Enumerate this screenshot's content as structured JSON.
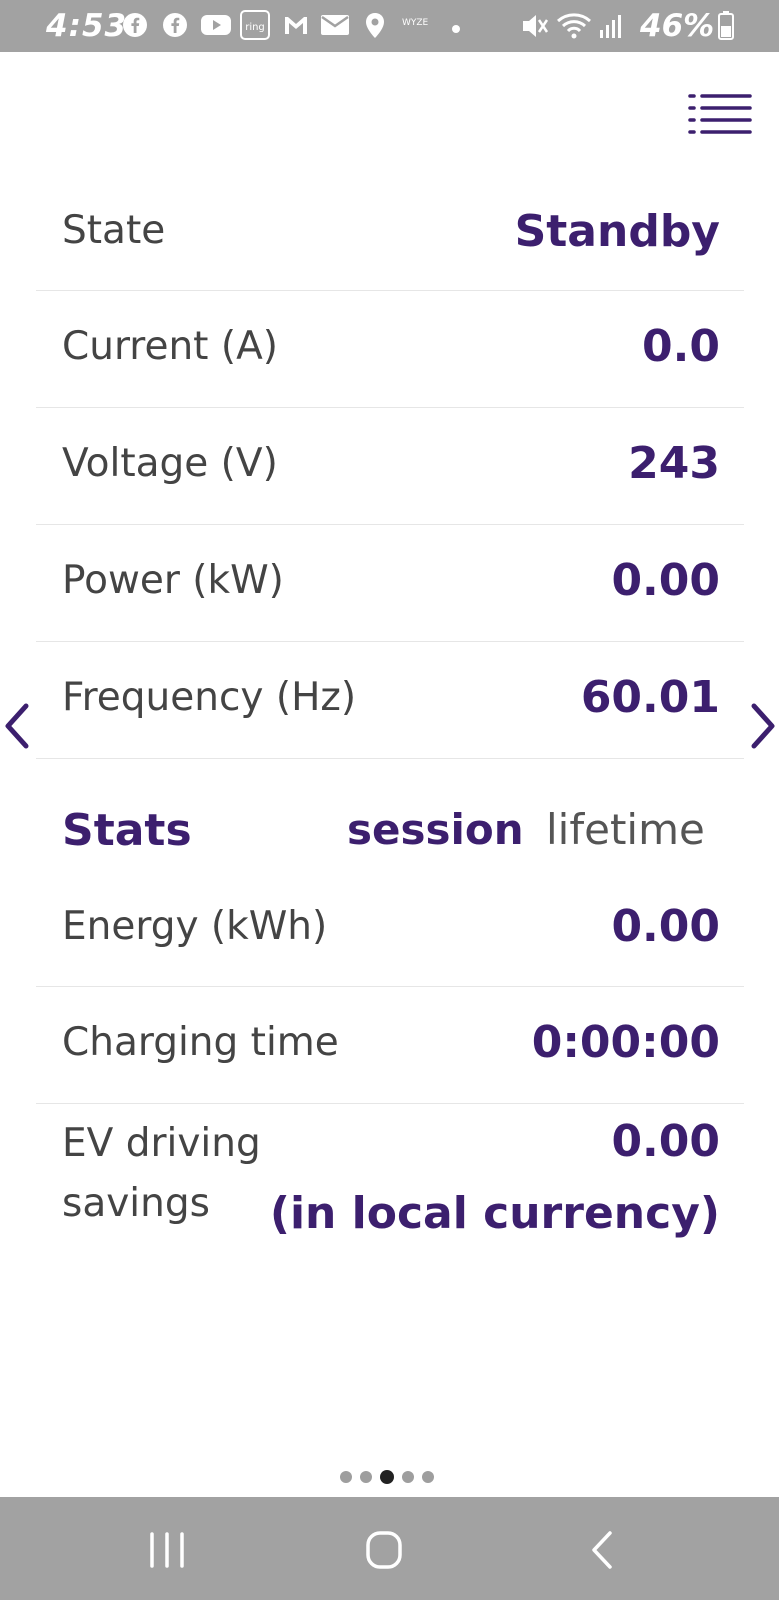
{
  "status_bar": {
    "time": "4:53",
    "battery_percent": "46%",
    "icons": [
      "facebook-icon",
      "facebook-icon",
      "youtube-icon",
      "ring-icon",
      "gmail-icon",
      "mail-icon",
      "location-icon",
      "wyze-icon",
      "dot-icon",
      "mute-icon",
      "wifi-icon",
      "signal-icon",
      "battery-icon"
    ],
    "ring_label": "ring",
    "wyze_label": "WYZE"
  },
  "menu": {
    "icon": "list-menu-icon"
  },
  "rows": [
    {
      "label": "State",
      "value": "Standby"
    },
    {
      "label": "Current (A)",
      "value": "0.0"
    },
    {
      "label": "Voltage (V)",
      "value": "243"
    },
    {
      "label": "Power (kW)",
      "value": "0.00"
    },
    {
      "label": "Frequency (Hz)",
      "value": "60.01"
    }
  ],
  "stats": {
    "title": "Stats",
    "tab_session": "session",
    "tab_lifetime": "lifetime",
    "selected_tab": "session",
    "rows": [
      {
        "label": "Energy (kWh)",
        "value": "0.00"
      },
      {
        "label": "Charging time",
        "value": "0:00:00"
      }
    ],
    "savings": {
      "label_line1": "EV driving",
      "label_line2": "savings",
      "value": "0.00",
      "unit": "(in local currency)"
    }
  },
  "pager": {
    "count": 5,
    "active_index": 2
  },
  "arrows": {
    "prev": "chevron-left-icon",
    "next": "chevron-right-icon"
  },
  "colors": {
    "accent": "#3c1f6e",
    "text": "#444444",
    "bar": "#a2a2a2"
  }
}
